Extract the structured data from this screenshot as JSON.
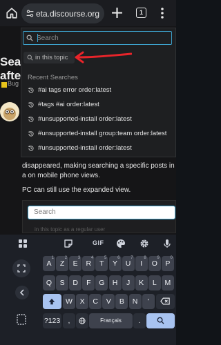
{
  "browser": {
    "url": "eta.discourse.org",
    "tab_count": "1"
  },
  "page": {
    "title_line1": "Sear",
    "title_line2": "afte",
    "category": "Bug",
    "body_text": "disappeared, making searching a specific posts in a on mobile phone views.",
    "body_text2": "PC can still use the expanded view.",
    "embedded_search_placeholder": "Search",
    "faint_text": "in this topic as a regular user"
  },
  "search": {
    "placeholder": "Search",
    "scope_chip": "in this topic",
    "recent_heading": "Recent Searches",
    "recent": [
      "#ai tags error order:latest",
      "#tags #ai order:latest",
      "#unsupported-install order:latest",
      "#unsupported-install group:team order:latest",
      "#unsupported-install order:latest"
    ]
  },
  "annotation": {
    "arrow_color": "#e8242a"
  },
  "keyboard": {
    "toolbar": [
      "grid-icon",
      "sticker-icon",
      "GIF",
      "palette-icon",
      "gear-icon",
      "mic-icon"
    ],
    "gif_label": "GIF",
    "row1": [
      {
        "k": "A",
        "h": "1"
      },
      {
        "k": "Z",
        "h": "2"
      },
      {
        "k": "E",
        "h": "3"
      },
      {
        "k": "R",
        "h": "4"
      },
      {
        "k": "T",
        "h": "5"
      },
      {
        "k": "Y",
        "h": "6"
      },
      {
        "k": "U",
        "h": "7"
      },
      {
        "k": "I",
        "h": "8"
      },
      {
        "k": "O",
        "h": "9"
      },
      {
        "k": "P",
        "h": "0"
      }
    ],
    "row2": [
      "Q",
      "S",
      "D",
      "F",
      "G",
      "H",
      "J",
      "K",
      "L",
      "M"
    ],
    "row3": [
      "W",
      "X",
      "C",
      "V",
      "B",
      "N",
      "'"
    ],
    "symbols_key": "?123",
    "comma_key": ",",
    "space_label": "Français",
    "period_key": ".",
    "colors": {
      "accent": "#a8c3f0",
      "focus": "#3da2cc"
    }
  }
}
